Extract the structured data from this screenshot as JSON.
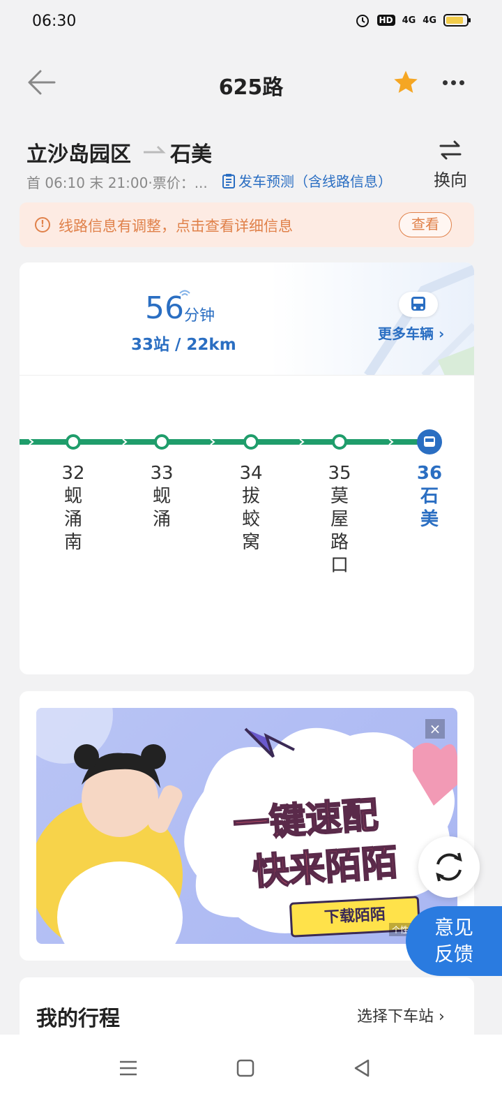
{
  "status_bar": {
    "time": "06:30",
    "signal_1": "4G",
    "signal_2": "4G",
    "hd_badge": "HD",
    "battery_level": 0.85
  },
  "header": {
    "title": "625路"
  },
  "route": {
    "from": "立沙岛园区",
    "to": "石美",
    "meta": "首 06:10 末 21:00·票价：...",
    "predict_link": "发车预测（含线路信息）",
    "switch_label": "换向"
  },
  "notice": {
    "text": "线路信息有调整，点击查看详细信息",
    "button": "查看"
  },
  "eta": {
    "minutes": "56",
    "unit": "分钟",
    "stats": "33站 / 22km",
    "more_vehicles": "更多车辆 ›"
  },
  "stops": [
    {
      "num": "32",
      "name": [
        "蚬",
        "涌",
        "南"
      ],
      "current": false
    },
    {
      "num": "33",
      "name": [
        "蚬",
        "涌"
      ],
      "current": false
    },
    {
      "num": "34",
      "name": [
        "拔",
        "蛟",
        "窝"
      ],
      "current": false
    },
    {
      "num": "35",
      "name": [
        "莫",
        "屋",
        "路",
        "口"
      ],
      "current": false
    },
    {
      "num": "36",
      "name": [
        "石",
        "美"
      ],
      "current": true
    }
  ],
  "ad": {
    "headline_1": "一键速配",
    "headline_2": "快来陌陌",
    "cta": "下载陌陌",
    "tag": "个性",
    "close": "×"
  },
  "feedback": {
    "line1": "意见",
    "line2": "反馈"
  },
  "trip": {
    "title": "我的行程",
    "action": "选择下车站 ›"
  },
  "colors": {
    "accent": "#2a6ec2",
    "line": "#1f9d6b",
    "notice": "#e0814a",
    "star": "#f5a623"
  },
  "icons": [
    "back-arrow-icon",
    "star-icon",
    "more-icon",
    "switch-icon",
    "document-icon",
    "info-icon",
    "bus-icon",
    "refresh-icon",
    "menu-icon",
    "home-icon",
    "back-triangle-icon"
  ]
}
